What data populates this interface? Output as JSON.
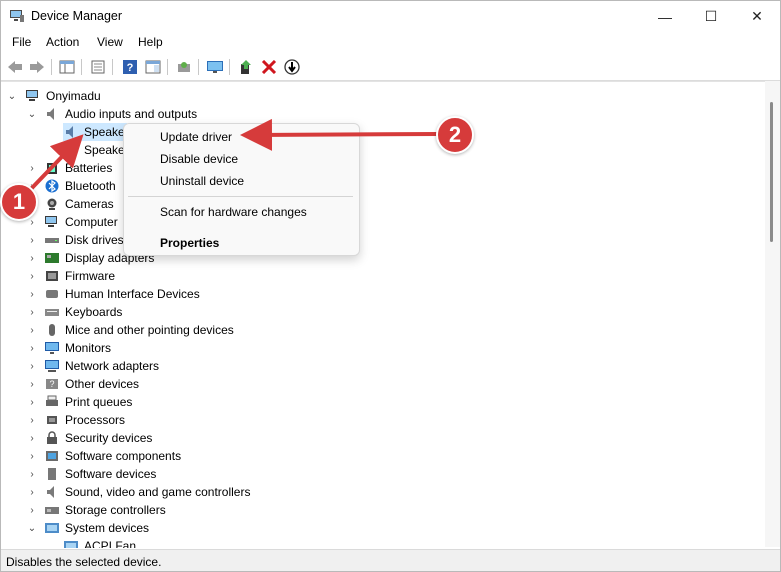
{
  "window": {
    "title": "Device Manager",
    "controls": [
      "—",
      "☐",
      "✕"
    ]
  },
  "menu": [
    "File",
    "Action",
    "View",
    "Help"
  ],
  "tree": {
    "root": "Onyimadu",
    "audio": {
      "label": "Audio inputs and outputs",
      "children": [
        "Speake",
        "Speake"
      ]
    },
    "categories": [
      "Batteries",
      "Bluetooth",
      "Cameras",
      "Computer",
      "Disk drives",
      "Display adapters",
      "Firmware",
      "Human Interface Devices",
      "Keyboards",
      "Mice and other pointing devices",
      "Monitors",
      "Network adapters",
      "Other devices",
      "Print queues",
      "Processors",
      "Security devices",
      "Software components",
      "Software devices",
      "Sound, video and game controllers",
      "Storage controllers"
    ],
    "system": {
      "label": "System devices",
      "child": "ACPI Fan"
    }
  },
  "context_menu": {
    "items": [
      "Update driver",
      "Disable device",
      "Uninstall device"
    ],
    "scan": "Scan for hardware changes",
    "properties": "Properties"
  },
  "status": "Disables the selected device.",
  "annotations": [
    "1",
    "2"
  ],
  "colors": {
    "accent": "#d63b3b",
    "selection": "#cde8ff"
  }
}
